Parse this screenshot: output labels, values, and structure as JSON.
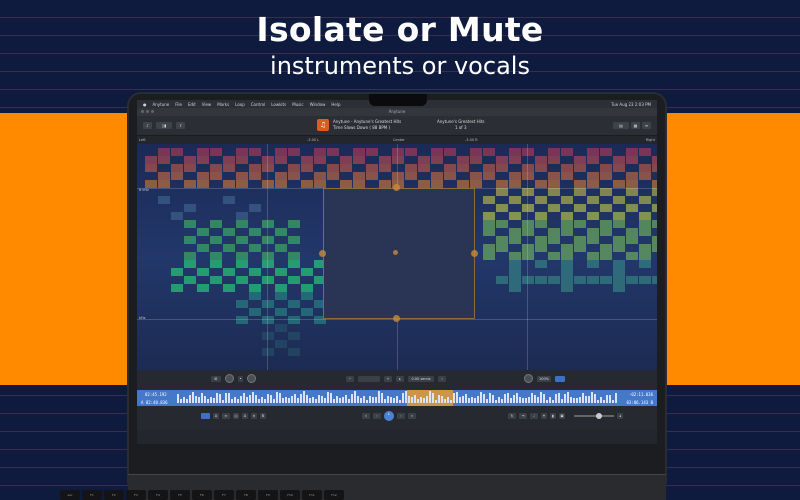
{
  "headline": "Isolate or Mute",
  "subline": "instruments or vocals",
  "menubar": {
    "items": [
      "Anytune",
      "File",
      "Edit",
      "View",
      "Marks",
      "Loop",
      "Control",
      "Lowkits",
      "Music",
      "Window",
      "Help"
    ],
    "clock": "Tue Aug 23  2:03 PM"
  },
  "window_title": "Anytune",
  "track": {
    "title": "Anytune - Anytune's Greatest Hits",
    "subtitle": "Time Slows Down  ( 88 BPM )",
    "album": "Anytune's Greatest Hits",
    "position": "1 of 3"
  },
  "ruler": {
    "left": "Left",
    "mid1": "-3.00 L",
    "center": "Center",
    "mid2": "-3.00 R",
    "right": "Right"
  },
  "freq_labels": [
    "6 kHz",
    "kHz"
  ],
  "times": {
    "current": "02:45.192",
    "loop_start": "A 02:40.836",
    "end": "-02:11.036",
    "loop_end": "03:06.143 B"
  },
  "controls": {
    "semis": "0.00 semis",
    "speed": "100%"
  },
  "keyboard": [
    "esc",
    "F1",
    "F2",
    "F3",
    "F4",
    "F5",
    "F6",
    "F7",
    "F8",
    "F9",
    "F10",
    "F11",
    "F12"
  ]
}
